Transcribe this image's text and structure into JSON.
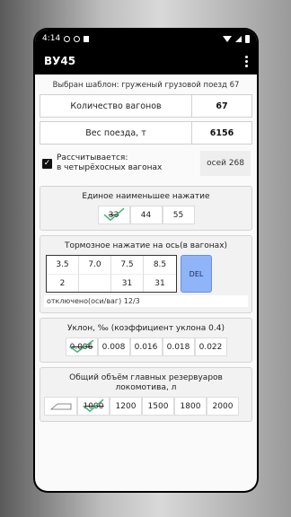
{
  "status": {
    "time": "4:14"
  },
  "appbar": {
    "title": "ВУ45"
  },
  "template_label": "Выбран шаблон: груженый грузовой поезд 67",
  "wagons": {
    "label": "Количество вагонов",
    "value": "67"
  },
  "weight": {
    "label": "Вес поезда, т",
    "value": "6156"
  },
  "calc": {
    "line1": "Рассчитывается:",
    "line2": "в четырёхосных вагонах",
    "axles": "осей 268",
    "checked": true
  },
  "single_press": {
    "title": "Единое наименьшее нажатие",
    "options": [
      "33",
      "44",
      "55"
    ],
    "selected": "33"
  },
  "brake": {
    "title": "Тормозное нажатие на ось(в вагонах)",
    "cells": [
      {
        "top": "3.5",
        "bottom": "2"
      },
      {
        "top": "7.0",
        "bottom": ""
      },
      {
        "top": "7.5",
        "bottom": "31"
      },
      {
        "top": "8.5",
        "bottom": "31"
      }
    ],
    "del_label": "DEL",
    "off_text": "отключено(оси/ваг) 12/3"
  },
  "slope": {
    "title": "Уклон, ‰ (коэффициент уклона 0.4)",
    "options": [
      "0.006",
      "0.008",
      "0.016",
      "0.018",
      "0.022"
    ],
    "selected": "0.006"
  },
  "volume": {
    "title": "Общий объём главных резервуаров локомотива, л",
    "options": [
      "1000",
      "1200",
      "1500",
      "1800",
      "2000"
    ],
    "selected": "1000"
  },
  "colors": {
    "check": "#3cb371",
    "del": "#8fb4f7"
  }
}
